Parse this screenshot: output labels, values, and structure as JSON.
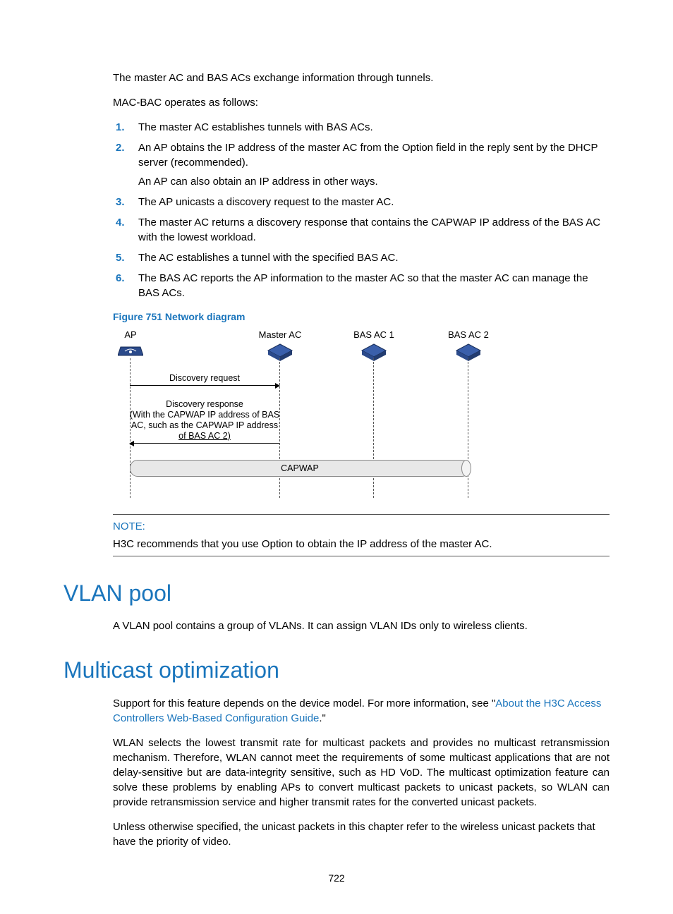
{
  "intro1": "The master AC and BAS ACs exchange information through tunnels.",
  "intro2": "MAC-BAC operates as follows:",
  "steps": [
    "The master AC establishes tunnels with BAS ACs.",
    "An AP obtains the IP address of the master AC from the Option field in the reply sent by the DHCP server (recommended).",
    "The AP unicasts a discovery request to the master AC.",
    "The master AC returns a discovery response that contains the CAPWAP IP address of the BAS AC with the lowest workload.",
    "The AC establishes a tunnel with the specified BAS AC.",
    "The BAS AC reports the AP information to the master AC so that the master AC can manage the BAS ACs."
  ],
  "step2_sub": "An AP can also obtain an IP address in other ways.",
  "figure_caption": "Figure 751 Network diagram",
  "diagram": {
    "ap": "AP",
    "master": "Master AC",
    "bas1": "BAS AC 1",
    "bas2": "BAS AC 2",
    "discovery_req": "Discovery request",
    "discovery_resp_l1": "Discovery response",
    "discovery_resp_l2": "(With the CAPWAP IP address of BAS",
    "discovery_resp_l3": "AC, such as the CAPWAP IP address",
    "discovery_resp_l4": "of BAS AC 2)",
    "capwap": "CAPWAP"
  },
  "note": {
    "title": "NOTE:",
    "body": "H3C recommends that you use Option to obtain the IP address of the master AC."
  },
  "vlan": {
    "heading": "VLAN pool",
    "body": "A VLAN pool contains a group of VLANs. It can assign VLAN IDs only to wireless clients."
  },
  "multicast": {
    "heading": "Multicast optimization",
    "p1_a": "Support for this feature depends on the device model. For more information, see \"",
    "p1_link": "About the H3C Access Controllers Web-Based Configuration Guide",
    "p1_b": ".\"",
    "p2": "WLAN selects the lowest transmit rate for multicast packets and provides no multicast retransmission mechanism. Therefore, WLAN cannot meet the requirements of some multicast applications that are not delay-sensitive but are data-integrity sensitive, such as HD VoD. The multicast optimization feature can solve these problems by enabling APs to convert multicast packets to unicast packets, so WLAN can provide retransmission service and higher transmit rates for the converted unicast packets.",
    "p3": "Unless otherwise specified, the unicast packets in this chapter refer to the wireless unicast packets that have the priority of video."
  },
  "page_number": "722"
}
